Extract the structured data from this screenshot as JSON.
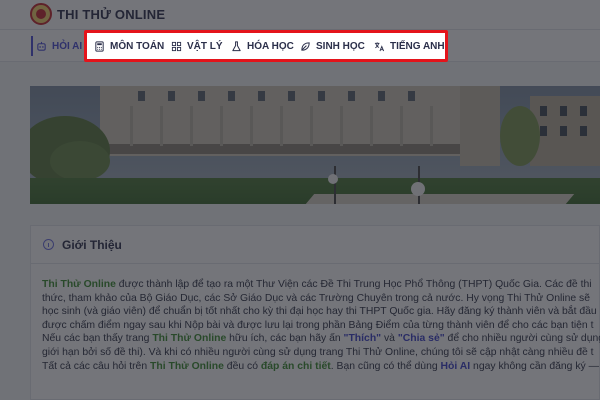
{
  "header": {
    "title": "THI THỬ ONLINE"
  },
  "nav": {
    "items": [
      {
        "id": "hoi-ai",
        "label": "HỎI AI",
        "icon": "robot-icon"
      },
      {
        "id": "mon-toan",
        "label": "MÔN TOÁN",
        "icon": "calculator-icon"
      },
      {
        "id": "vat-ly",
        "label": "VẬT LÝ",
        "icon": "atom-icon"
      },
      {
        "id": "hoa-hoc",
        "label": "HÓA HỌC",
        "icon": "flask-icon"
      },
      {
        "id": "sinh-hoc",
        "label": "SINH HỌC",
        "icon": "leaf-icon"
      },
      {
        "id": "tieng-anh",
        "label": "TIẾNG ANH",
        "icon": "translate-icon"
      }
    ],
    "active": "hoi-ai"
  },
  "intro": {
    "title": "Giới Thiệu",
    "lines": [
      [
        {
          "t": "Thi Thử Online",
          "c": "g"
        },
        {
          "t": " được thành lập để tạo ra một Thư Viện các Đề Thi Trung Học Phổ Thông (THPT) Quốc Gia. Các đề thi"
        }
      ],
      [
        {
          "t": "thức, tham khảo của Bộ Giáo Dục, các Sở Giáo Dục và các Trường Chuyên trong cả nước. Hy vọng Thi Thử Online sẽ"
        }
      ],
      [
        {
          "t": "học sinh (và giáo viên) để chuẩn bị tốt nhất cho kỳ thi đại học hay thi THPT Quốc gia. Hãy đăng ký thành viên và bắt đầu"
        }
      ],
      [
        {
          "t": "được chấm điểm ngay sau khi Nộp bài và được lưu lại trong phần Bảng Điểm của từng thành viên để cho các bạn tiện t"
        }
      ],
      [
        {
          "t": "Nếu các bạn thấy trang "
        },
        {
          "t": "Thi Thử Online",
          "c": "g"
        },
        {
          "t": " hữu ích, các bạn hãy ấn "
        },
        {
          "t": "\"Thích\"",
          "c": "b"
        },
        {
          "t": " và "
        },
        {
          "t": "\"Chia sẻ\"",
          "c": "b"
        },
        {
          "t": " để cho nhiều người cùng sử dụng"
        }
      ],
      [
        {
          "t": "giới hạn bởi số đề thi). Và khi có nhiều người cùng sử dụng trang Thi Thử Online, chúng tôi sẽ cập nhật càng nhiều đề t"
        }
      ],
      [
        {
          "t": "Tất cả các câu hỏi trên "
        },
        {
          "t": "Thi Thử Online",
          "c": "g"
        },
        {
          "t": " đều có "
        },
        {
          "t": "đáp án chi tiết",
          "c": "g"
        },
        {
          "t": ". Bạn cũng có thể dùng "
        },
        {
          "t": "Hỏi AI",
          "c": "b"
        },
        {
          "t": " ngay không cần đăng ký —"
        }
      ]
    ]
  },
  "colors": {
    "accent": "#4a4ed8",
    "highlight": "#e4141b",
    "link_green": "#3a8d2f",
    "link_blue": "#3c40c8"
  }
}
